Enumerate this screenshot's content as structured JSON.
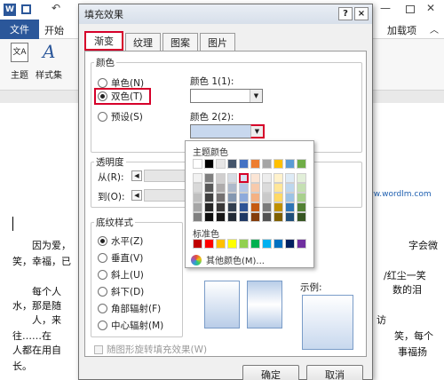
{
  "word": {
    "file_tab": "文件",
    "home_tab": "开始",
    "addins_tab": "加载项",
    "ribbon_labels": [
      "主题",
      "样式集"
    ],
    "doc_lines": [
      "因为爱，",
      "笑，幸福，已",
      "每个人",
      "水，那是随",
      "人，来",
      "往……在",
      "人都在用自",
      "长。"
    ],
    "doc_right_lines": [
      "字会微",
      "/红尘一笑",
      "数的泪",
      "访",
      "笑，每个",
      "事福扬"
    ],
    "watermark": "www.wordlm.com"
  },
  "dialog": {
    "title": "填充效果",
    "help": "?",
    "close": "×",
    "tabs": [
      "渐变",
      "纹理",
      "图案",
      "图片"
    ],
    "colors_group": "颜色",
    "radio_one": "单色(N)",
    "radio_two": "双色(T)",
    "radio_preset": "预设(S)",
    "color1_label": "颜色 1(1):",
    "color2_label": "颜色 2(2):",
    "transparency_group": "透明度",
    "from_label": "从(R):",
    "to_label": "到(O):",
    "shading_group": "底纹样式",
    "shading_options": [
      "水平(Z)",
      "垂直(V)",
      "斜上(U)",
      "斜下(D)",
      "角部辐射(F)",
      "中心辐射(M)"
    ],
    "rotate_checkbox": "随图形旋转填充效果(W)",
    "sample_label": "示例:",
    "ok": "确定",
    "cancel": "取消"
  },
  "color_popup": {
    "theme_label": "主题颜色",
    "standard_label": "标准色",
    "more_colors": "其他颜色(M)...",
    "theme_top_row": [
      "#ffffff",
      "#000000",
      "#e7e6e6",
      "#44546a",
      "#4472c4",
      "#ed7d31",
      "#a5a5a5",
      "#ffc000",
      "#5b9bd5",
      "#70ad47"
    ],
    "theme_columns": [
      [
        "#f2f2f2",
        "#d9d9d9",
        "#bfbfbf",
        "#a6a6a6",
        "#808080"
      ],
      [
        "#7f7f7f",
        "#595959",
        "#404040",
        "#262626",
        "#0d0d0d"
      ],
      [
        "#d0cece",
        "#aeabab",
        "#757171",
        "#3a3838",
        "#171616"
      ],
      [
        "#d6dce4",
        "#adb9ca",
        "#8497b0",
        "#333f4f",
        "#222a35"
      ],
      [
        "#d9e2f3",
        "#b4c6e7",
        "#8eaadb",
        "#2f5496",
        "#1f3864"
      ],
      [
        "#fbe5d5",
        "#f7caac",
        "#f4b183",
        "#c55a11",
        "#833c0b"
      ],
      [
        "#ededed",
        "#dbdbdb",
        "#c9c9c9",
        "#7b7b7b",
        "#525252"
      ],
      [
        "#fff2cc",
        "#ffe699",
        "#ffd966",
        "#bf9000",
        "#7f6000"
      ],
      [
        "#deebf6",
        "#bdd7ee",
        "#9cc3e5",
        "#2e75b5",
        "#1f4e79"
      ],
      [
        "#e2efd9",
        "#c5e0b3",
        "#a8d08d",
        "#538135",
        "#375623"
      ]
    ],
    "standard_colors": [
      "#c00000",
      "#ff0000",
      "#ffc000",
      "#ffff00",
      "#92d050",
      "#00b050",
      "#00b0f0",
      "#0070c0",
      "#002060",
      "#7030a0"
    ]
  }
}
